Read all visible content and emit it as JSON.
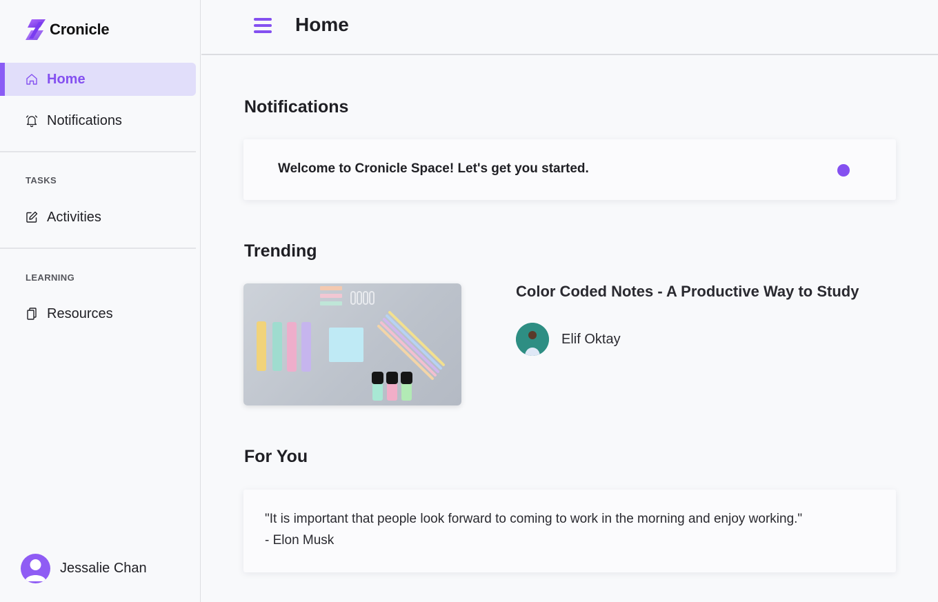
{
  "brand": {
    "name": "Cronicle",
    "accent": "#8450f0"
  },
  "sidebar": {
    "items": [
      {
        "label": "Home",
        "icon": "home-icon",
        "active": true
      },
      {
        "label": "Notifications",
        "icon": "bell-icon",
        "active": false
      }
    ],
    "sections": [
      {
        "label": "TASKS",
        "items": [
          {
            "label": "Activities",
            "icon": "edit-icon"
          }
        ]
      },
      {
        "label": "LEARNING",
        "items": [
          {
            "label": "Resources",
            "icon": "copy-icon"
          }
        ]
      }
    ],
    "user": {
      "name": "Jessalie Chan"
    }
  },
  "header": {
    "title": "Home",
    "menu_icon": "hamburger-menu-icon"
  },
  "main": {
    "notifications": {
      "heading": "Notifications",
      "items": [
        {
          "text": "Welcome to Cronicle Space! Let's get you started.",
          "unread": true
        }
      ]
    },
    "trending": {
      "heading": "Trending",
      "article": {
        "title": "Color Coded Notes - A Productive Way to Study",
        "author": "Elif Oktay"
      }
    },
    "for_you": {
      "heading": "For You",
      "quote": "\"It is important that people look forward to coming to work in the morning and enjoy working.\"",
      "attribution": "- Elon Musk"
    }
  }
}
